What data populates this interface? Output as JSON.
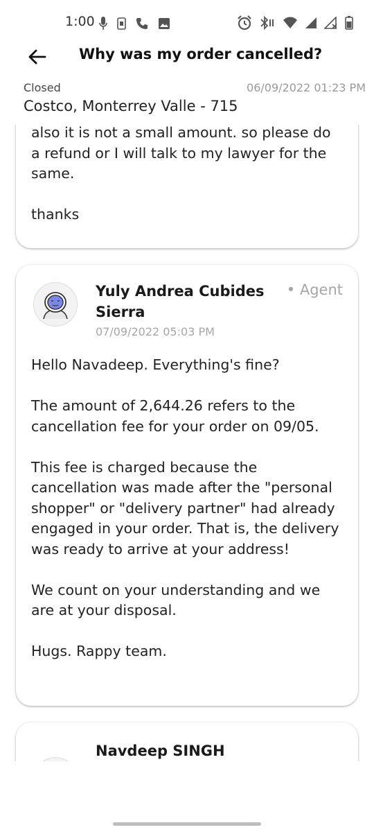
{
  "status_bar": {
    "time": "1:00",
    "left_icons": [
      "mic-icon",
      "sim-icon",
      "phone-icon",
      "image-icon"
    ],
    "right_icons": [
      "alarm-icon",
      "bluetooth-icon",
      "wifi-icon",
      "signal-icon",
      "signal-x-icon",
      "battery-icon"
    ]
  },
  "header": {
    "title": "Why was my order cancelled?"
  },
  "ticket": {
    "status": "Closed",
    "date": "06/09/2022 01:23 PM",
    "store": "Costco, Monterrey Valle - 715"
  },
  "messages": [
    {
      "text": "also it is not a small amount. so please do a refund or I will talk to my lawyer for the same.\n\nthanks"
    },
    {
      "author": "Yuly Andrea Cubides Sierra",
      "role": "• Agent",
      "date": "07/09/2022 05:03 PM",
      "text": "Hello Navadeep. Everything's fine?\n\nThe amount of 2,644.26 refers to the cancellation fee for your order on 09/05.\n\nThis fee is charged because the cancellation was made after the \"personal shopper\" or \"delivery partner\" had already engaged in your order. That is, the delivery was ready to arrive at your address!\n\nWe count on your understanding and we are at your disposal.\n\nHugs. Rappy team."
    },
    {
      "author": "Navdeep SINGH"
    }
  ],
  "colors": {
    "background": "#ffffff",
    "muted_text": "#a6a6a6",
    "avatar_face": "#7b86e8"
  }
}
